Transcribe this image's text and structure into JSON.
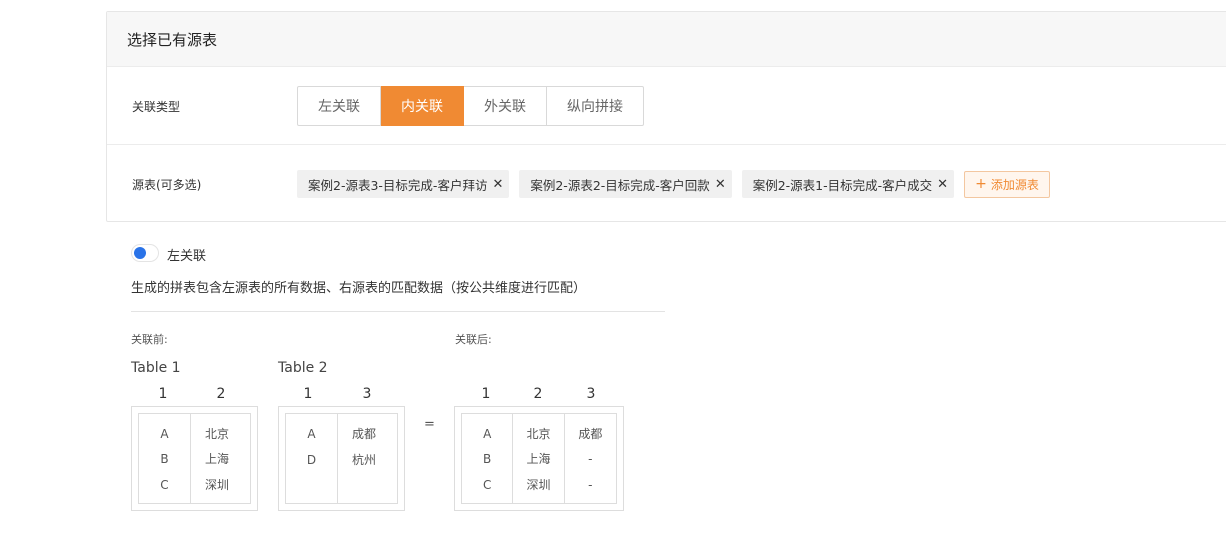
{
  "panel": {
    "title": "选择已有源表",
    "join_type_label": "关联类型",
    "join_types": [
      "左关联",
      "内关联",
      "外关联",
      "纵向拼接"
    ],
    "active_join_type": "内关联",
    "source_label": "源表(可多选)",
    "sources": [
      "案例2-源表3-目标完成-客户拜访",
      "案例2-源表2-目标完成-客户回款",
      "案例2-源表1-目标完成-客户成交"
    ],
    "add_source_label": "添加源表",
    "accent_color": "#f08a33"
  },
  "explain": {
    "toggle_title": "左关联",
    "description": "生成的拼表包含左源表的所有数据、右源表的匹配数据（按公共维度进行匹配）",
    "before_label": "关联前:",
    "after_label": "关联后:",
    "equals": "=",
    "table1": {
      "title": "Table 1",
      "columns": [
        "1",
        "2"
      ],
      "cols": [
        [
          "A",
          "B",
          "C"
        ],
        [
          "北京",
          "上海",
          "深圳"
        ]
      ]
    },
    "table2": {
      "title": "Table 2",
      "columns": [
        "1",
        "3"
      ],
      "cols": [
        [
          "A",
          "D"
        ],
        [
          "成都",
          "杭州"
        ]
      ]
    },
    "result": {
      "columns": [
        "1",
        "2",
        "3"
      ],
      "cols": [
        [
          "A",
          "B",
          "C"
        ],
        [
          "北京",
          "上海",
          "深圳"
        ],
        [
          "成都",
          "-",
          "-"
        ]
      ]
    }
  }
}
